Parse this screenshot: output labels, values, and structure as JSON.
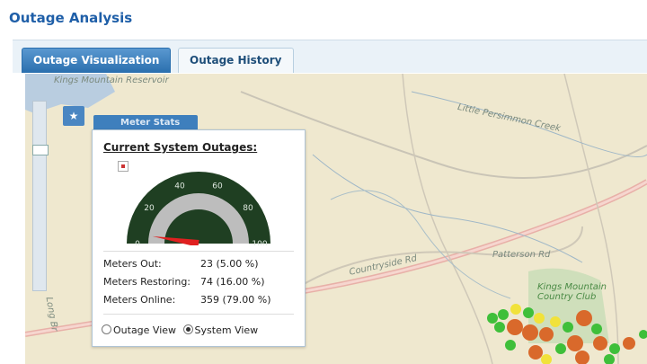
{
  "header": {
    "title": "Outage Analysis"
  },
  "tabs": [
    {
      "label": "Outage Visualization",
      "active": true
    },
    {
      "label": "Outage History",
      "active": false
    }
  ],
  "map": {
    "labels": {
      "top_left_place": "Kings Mountain Reservoir",
      "creek": "Little Persimmon Creek",
      "road_1": "Countryside Rd",
      "road_2": "Patterson Rd",
      "road_3": "Long Br",
      "place_2": "Kings Mountain Country Club"
    },
    "colors": {
      "green": "#3fbf3a",
      "yellow": "#f1e23a",
      "orange": "#d9692b"
    }
  },
  "meter_tab": {
    "label": "Meter Stats"
  },
  "panel": {
    "title": "Current System Outages:",
    "gauge": {
      "value_percent": 5,
      "ticks": [
        "0",
        "20",
        "40",
        "60",
        "80",
        "100"
      ],
      "colors": {
        "face": "#1f3f22",
        "ring": "#bdbdbd",
        "needle": "#e02020"
      }
    },
    "stats": [
      {
        "label": "Meters Out:",
        "value": "23 (5.00 %)"
      },
      {
        "label": "Meters Restoring:",
        "value": "74 (16.00 %)"
      },
      {
        "label": "Meters Online:",
        "value": "359 (79.00 %)"
      }
    ],
    "views": [
      {
        "label": "Outage View",
        "selected": false
      },
      {
        "label": "System View",
        "selected": true
      }
    ]
  }
}
